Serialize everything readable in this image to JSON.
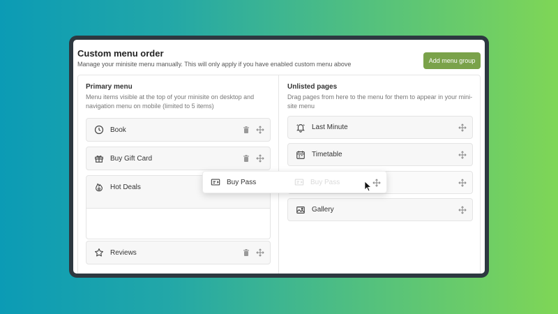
{
  "header": {
    "title": "Custom menu order",
    "subtitle": "Manage your minisite menu manually. This will only apply if you have enabled custom menu above",
    "add_button_label": "Add menu group"
  },
  "primary": {
    "title": "Primary menu",
    "desc_line1": "Menu items visible at the top of your minisite on desktop and",
    "desc_line2": "navigation menu on mobile (limited to 5 items)",
    "items": [
      {
        "label": "Book",
        "icon": "clock-icon"
      },
      {
        "label": "Buy Gift Card",
        "icon": "gift-icon"
      },
      {
        "label": "Hot Deals",
        "icon": "fire-icon"
      },
      {
        "label": "Reviews",
        "icon": "star-icon"
      }
    ]
  },
  "unlisted": {
    "title": "Unlisted pages",
    "desc_line1": "Drag pages from here to the menu for them to appear in your mini-",
    "desc_line2": "site menu",
    "items": [
      {
        "label": "Last Minute",
        "icon": "bell-icon"
      },
      {
        "label": "Timetable",
        "icon": "calendar-icon"
      },
      {
        "label": "Gallery",
        "icon": "image-icon"
      }
    ]
  },
  "dragging": {
    "label": "Buy Pass",
    "icon": "ticket-icon"
  },
  "colors": {
    "accent": "#7aa24a",
    "frame": "#2d3840"
  }
}
